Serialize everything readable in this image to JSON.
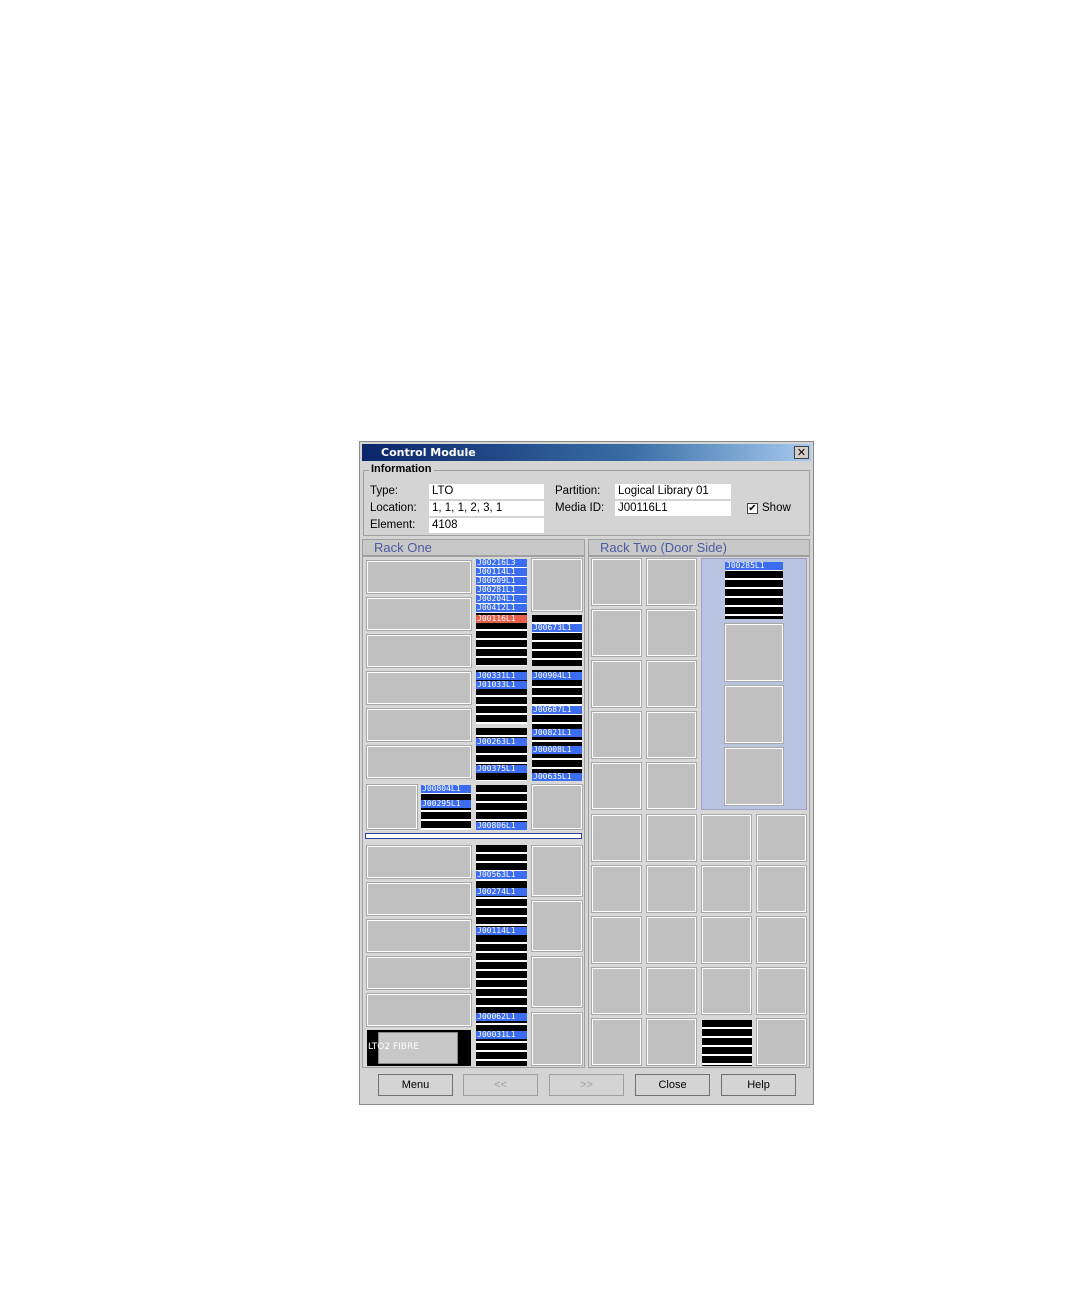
{
  "window": {
    "title": "Control Module",
    "close_glyph": "✕"
  },
  "information": {
    "title": "Information",
    "type_label": "Type:",
    "type_value": "LTO",
    "location_label": "Location:",
    "location_value": "1, 1, 1, 2, 3, 1",
    "element_label": "Element:",
    "element_value": "4108",
    "partition_label": "Partition:",
    "partition_value": "Logical Library 01",
    "media_label": "Media ID:",
    "media_value": "J00116L1",
    "show_label": "Show",
    "show_checked": true
  },
  "racks": {
    "one_title": "Rack One",
    "two_title": "Rack Two (Door Side)"
  },
  "tapes": {
    "c1a": [
      "J00216L3",
      "J00114L1",
      "J00609L1",
      "J00281L1",
      "J00204L1",
      "J00412L1"
    ],
    "selected": "J00116L1",
    "c2a": "J00673L1",
    "c1b": [
      "J00331L1",
      "J01033L1"
    ],
    "c2b": [
      "J00904L1",
      "J00687L1",
      "J00821L1",
      "J00008L1",
      "J00635L1"
    ],
    "c1c": [
      "J00263L1",
      "J00375L1",
      "J00806L1"
    ],
    "c0": [
      "J00804L1",
      "J00295L1"
    ],
    "c1d": [
      "J00563L1",
      "J00274L1",
      "J00114L1",
      "J00062L1",
      "J00031L1"
    ],
    "r2": "J00285L1"
  },
  "drive_label": "LTO2 FIBRE",
  "buttons": {
    "menu": "Menu",
    "prev": "<<",
    "next": ">>",
    "close": "Close",
    "help": "Help"
  },
  "colors": {
    "tape": "#3c6cf0",
    "selected_tape": "#e8604c",
    "title_bar": "#0a246a"
  }
}
